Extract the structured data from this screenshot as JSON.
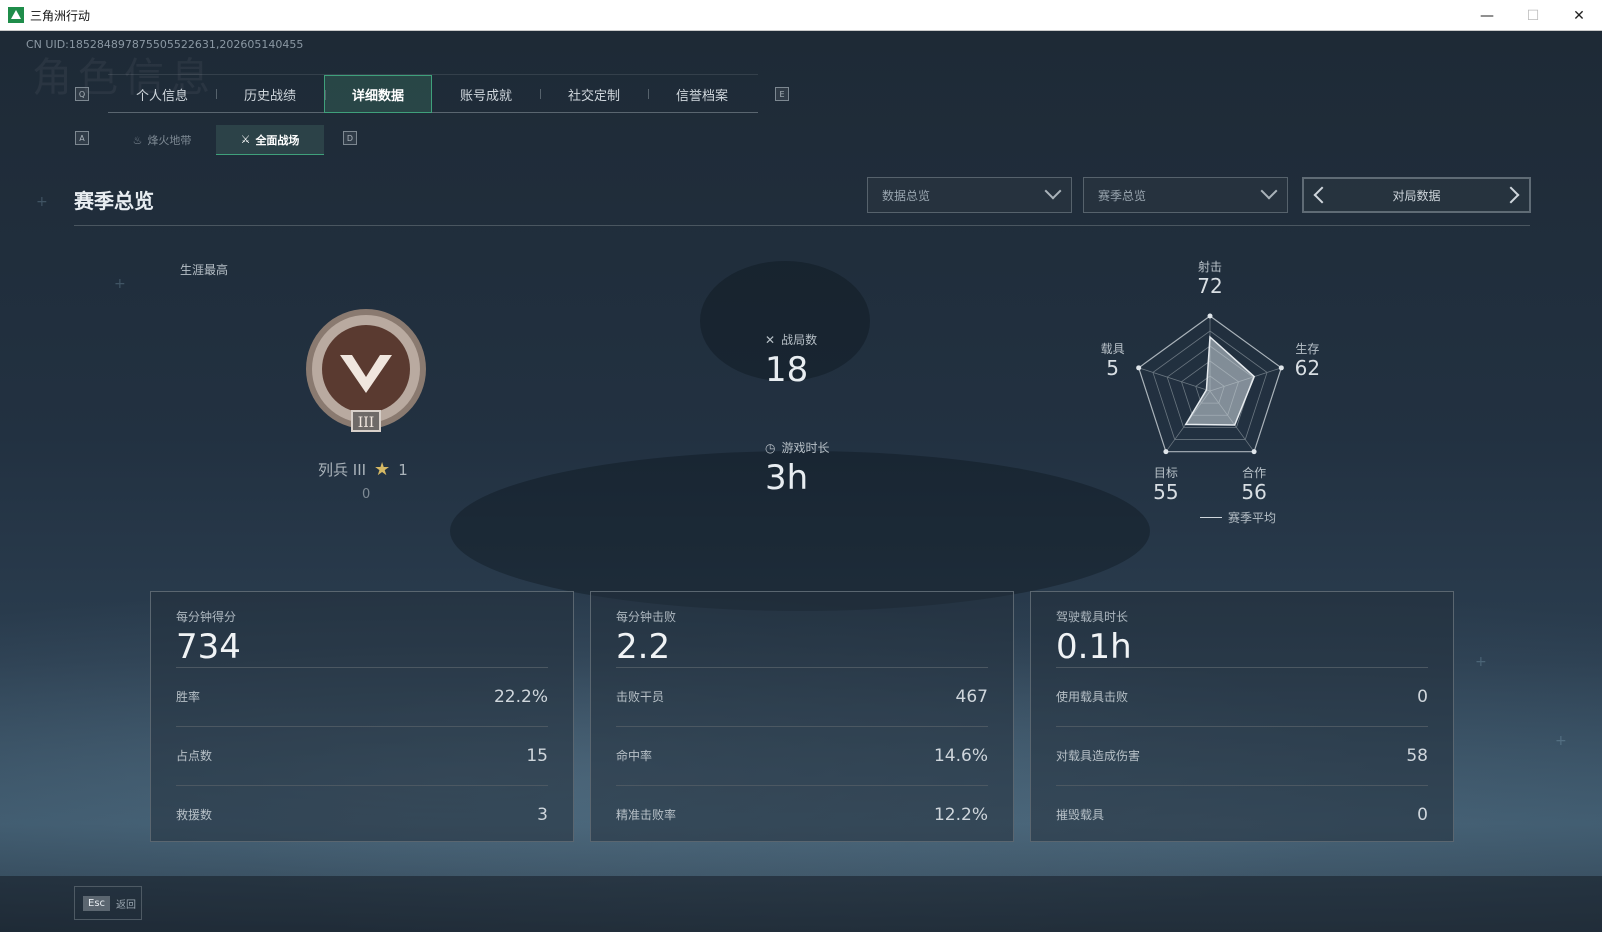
{
  "window": {
    "title": "三角洲行动",
    "minimize": "—",
    "maximize": "☐",
    "close": "✕"
  },
  "uid": "CN UID:1852848978755055226​31,202605140455",
  "watermark": "角色信息",
  "key_hints": {
    "prev_tab": "Q",
    "next_tab": "E",
    "prev_sub": "A",
    "next_sub": "D"
  },
  "tabs": [
    {
      "label": "个人信息"
    },
    {
      "label": "历史战绩"
    },
    {
      "label": "详细数据",
      "active": true
    },
    {
      "label": "账号成就"
    },
    {
      "label": "社交定制"
    },
    {
      "label": "信誉档案"
    }
  ],
  "subtabs": [
    {
      "label": "烽火地带",
      "icon": "flame-icon"
    },
    {
      "label": "全面战场",
      "icon": "battlefield-icon",
      "active": true
    }
  ],
  "section": {
    "title": "赛季总览",
    "dropdown1": "数据总览",
    "dropdown2": "赛季总览",
    "switcher": "对局数据"
  },
  "rank": {
    "career_label": "生涯最高",
    "name": "列兵 III",
    "stars": "1",
    "points": "0"
  },
  "mid_stats": {
    "matches_label": "战局数",
    "matches_value": "18",
    "time_label": "游戏时长",
    "time_value": "3h"
  },
  "radar": {
    "axes": [
      {
        "label": "射击",
        "value": 72
      },
      {
        "label": "生存",
        "value": 62
      },
      {
        "label": "合作",
        "value": 56
      },
      {
        "label": "目标",
        "value": 55
      },
      {
        "label": "载具",
        "value": 5
      }
    ],
    "legend": "赛季平均"
  },
  "cards": [
    {
      "title": "每分钟得分",
      "main": "734",
      "rows": [
        {
          "label": "胜率",
          "value": "22.2%"
        },
        {
          "label": "占点数",
          "value": "15"
        },
        {
          "label": "救援数",
          "value": "3"
        }
      ]
    },
    {
      "title": "每分钟击败",
      "main": "2.2",
      "rows": [
        {
          "label": "击败干员",
          "value": "467"
        },
        {
          "label": "命中率",
          "value": "14.6%"
        },
        {
          "label": "精准击败率",
          "value": "12.2%"
        }
      ]
    },
    {
      "title": "驾驶载具时长",
      "main": "0.1h",
      "rows": [
        {
          "label": "使用载具击败",
          "value": "0"
        },
        {
          "label": "对载具造成伤害",
          "value": "58"
        },
        {
          "label": "摧毁载具",
          "value": "0"
        }
      ]
    }
  ],
  "bottom": {
    "esc_key": "Esc",
    "esc_label": "返回"
  },
  "colors": {
    "accent": "#3fa07b",
    "star": "#d6b964",
    "background": "#1b2632"
  }
}
